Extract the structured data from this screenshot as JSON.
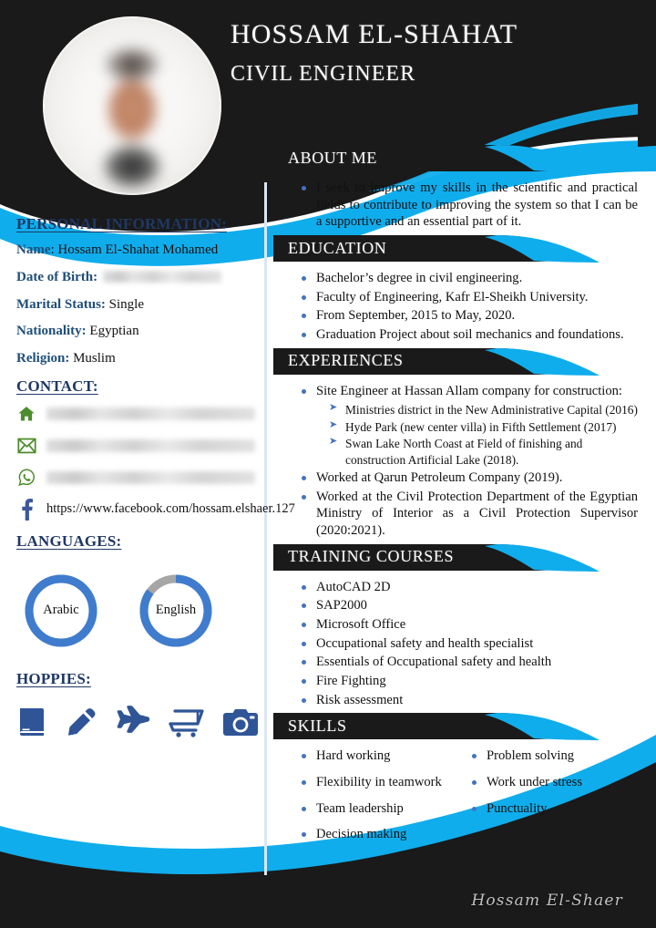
{
  "meta": {
    "accent_blue": "#10ADEC",
    "dark": "#1A1A1A",
    "heading_navy": "#1F3864",
    "label_blue": "#1F4E79",
    "bullet_blue": "#4472C4",
    "icon_green": "#4C8C2B",
    "icon_fb_blue": "#3B5998",
    "hobby_blue": "#2F5597",
    "divider_blue": "#DCE6F2"
  },
  "header": {
    "name": "HOSSAM EL-SHAHAT",
    "role": "CIVIL ENGINEER",
    "photo_alt": "profile-photo"
  },
  "personal": {
    "heading": "PERSONAL INFORMATION:",
    "rows": [
      {
        "label": "Name",
        "sep": ": ",
        "value": "Hossam El-Shahat Mohamed",
        "redacted": false
      },
      {
        "label": "Date of Birth:",
        "sep": " ",
        "value": "",
        "redacted": true,
        "redact_width": 130
      },
      {
        "label": "Marital Status:",
        "sep": " ",
        "value": "Single",
        "redacted": false
      },
      {
        "label": "Nationality:",
        "sep": " ",
        "value": "Egyptian",
        "redacted": false
      },
      {
        "label": "Religion:",
        "sep": " ",
        "value": "Muslim",
        "redacted": false
      }
    ]
  },
  "contact": {
    "heading": "CONTACT:",
    "rows": [
      {
        "icon": "home-icon",
        "value": "",
        "redacted": true
      },
      {
        "icon": "email-icon",
        "value": "",
        "redacted": true
      },
      {
        "icon": "whatsapp-icon",
        "value": "",
        "redacted": true
      },
      {
        "icon": "facebook-icon",
        "value": "https://www.facebook.com/hossam.elshaer.127",
        "redacted": false
      }
    ]
  },
  "languages": {
    "heading": "LANGUAGES:",
    "items": [
      {
        "name": "Arabic",
        "percent": 100
      },
      {
        "name": "English",
        "percent": 85
      }
    ]
  },
  "hobbies": {
    "heading": "HOPPIES:",
    "icons": [
      "book-icon",
      "pencil-icon",
      "airplane-icon",
      "shopping-cart-icon",
      "camera-icon"
    ]
  },
  "sections": [
    {
      "key": "about",
      "title": "ABOUT ME",
      "items": [
        "I seek to improve my skills in the scientific and practical fields to contribute to improving the system so that I can be a supportive and an essential part of it."
      ]
    },
    {
      "key": "education",
      "title": "EDUCATION",
      "items": [
        "Bachelor’s degree in civil engineering.",
        "Faculty of Engineering, Kafr El-Sheikh University.",
        "From September, 2015 to May, 2020.",
        "Graduation Project about soil mechanics and foundations."
      ]
    },
    {
      "key": "experiences",
      "title": "EXPERIENCES",
      "items": [
        "Site Engineer at Hassan Allam company for construction:",
        "Worked at Qarun Petroleum Company (2019).",
        "Worked at the Civil Protection Department of the Egyptian Ministry of Interior as a Civil Protection Supervisor (2020:2021)."
      ],
      "sub_items": [
        "Ministries district in the New Administrative Capital (2016)",
        "Hyde Park (new center villa) in Fifth Settlement (2017)",
        "Swan Lake North Coast at Field of finishing and construction Artificial Lake (2018)."
      ]
    },
    {
      "key": "training",
      "title": "TRAINING COURSES",
      "items": [
        "AutoCAD 2D",
        "SAP2000",
        "Microsoft Office",
        "Occupational safety and health specialist",
        "Essentials of Occupational safety and health",
        "Fire Fighting",
        "Risk assessment"
      ]
    },
    {
      "key": "skills",
      "title": "SKILLS",
      "column_left": [
        "Hard working",
        "Flexibility in teamwork",
        "Team leadership",
        "Decision making"
      ],
      "column_right": [
        "Problem solving",
        "Work under stress",
        "Punctuality"
      ]
    }
  ],
  "footer": {
    "signature": "Hossam El-Shaer"
  }
}
